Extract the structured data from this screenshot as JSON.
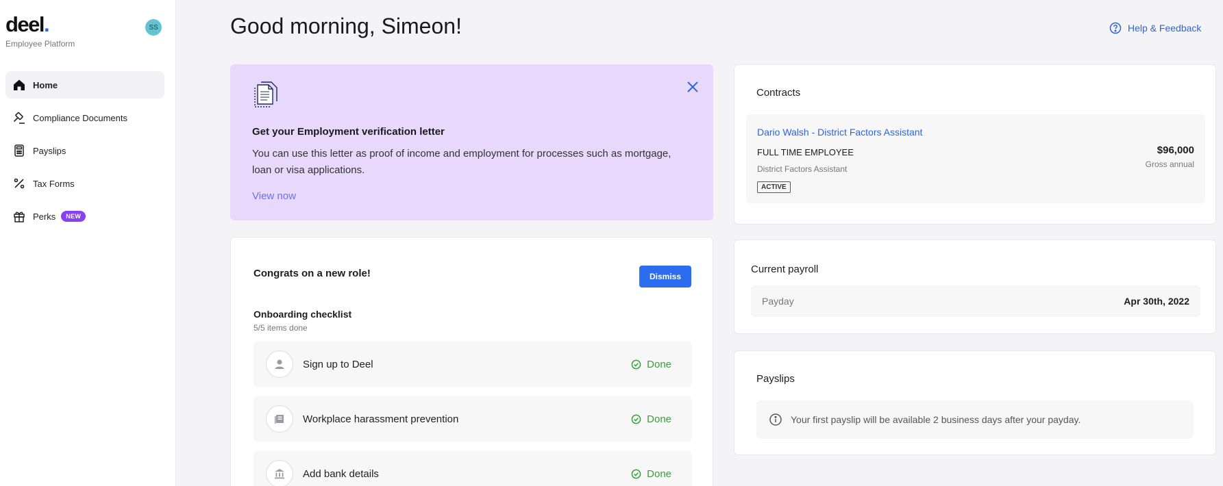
{
  "sidebar": {
    "logo": "deel",
    "logo_dot": ".",
    "subtitle": "Employee Platform",
    "avatar_initials": "SS",
    "items": [
      {
        "label": "Home",
        "icon": "home-icon"
      },
      {
        "label": "Compliance Documents",
        "icon": "gavel-icon"
      },
      {
        "label": "Payslips",
        "icon": "calculator-icon"
      },
      {
        "label": "Tax Forms",
        "icon": "percent-icon"
      },
      {
        "label": "Perks",
        "icon": "gift-icon",
        "badge": "NEW"
      }
    ]
  },
  "header": {
    "greeting": "Good morning, Simeon!",
    "help": "Help & Feedback"
  },
  "promo": {
    "title": "Get your Employment verification letter",
    "body": "You can use this letter as proof of income and employment for processes such as mortgage, loan or visa applications.",
    "link": "View now"
  },
  "onboarding": {
    "congrats": "Congrats on a new role!",
    "dismiss": "Dismiss",
    "title": "Onboarding checklist",
    "progress": "5/5 items done",
    "items": [
      {
        "label": "Sign up to Deel",
        "status": "Done",
        "icon": "user-icon"
      },
      {
        "label": "Workplace harassment prevention",
        "status": "Done",
        "icon": "book-icon"
      },
      {
        "label": "Add bank details",
        "status": "Done",
        "icon": "bank-icon"
      }
    ]
  },
  "contracts": {
    "title": "Contracts",
    "item": {
      "name": "Dario Walsh - District Factors Assistant",
      "type": "FULL TIME EMPLOYEE",
      "role": "District Factors Assistant",
      "status": "ACTIVE",
      "salary": "$96,000",
      "salary_label": "Gross annual"
    }
  },
  "payroll": {
    "title": "Current payroll",
    "label": "Payday",
    "value": "Apr 30th, 2022"
  },
  "payslips": {
    "title": "Payslips",
    "info": "Your first payslip will be available 2 business days after your payday."
  },
  "colors": {
    "accent": "#2c6df0",
    "promo_bg": "#e8d8fc",
    "success": "#3b9d3b",
    "badge": "#8a3ff0"
  }
}
